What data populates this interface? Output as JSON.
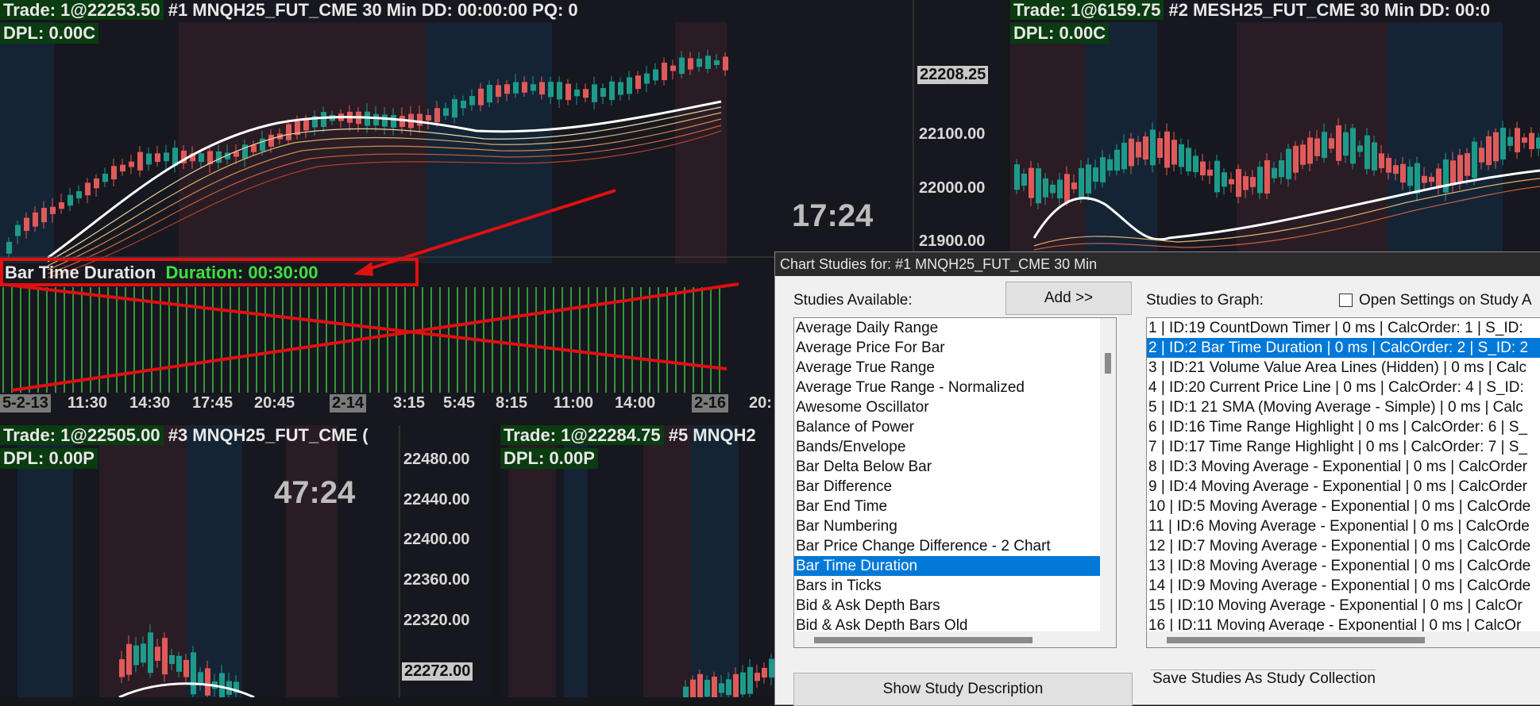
{
  "chart1": {
    "trade_label": "Trade: 1@22253.50",
    "title_rest": " #1 MNQH25_FUT_CME  30 Min  DD: 00:00:00 PQ: 0",
    "dpl": "DPL: 0.00C",
    "current_price": "22208.25",
    "price_labels": [
      "22100.00",
      "22000.00",
      "21900.00"
    ],
    "countdown": "17:24",
    "study_name": "Bar Time Duration",
    "study_value": "Duration: 00:30:00",
    "time_axis": [
      "5-2-13",
      "11:30",
      "14:30",
      "17:45",
      "20:45",
      "2-14",
      "3:15",
      "5:45",
      "8:15",
      "11:00",
      "14:00",
      "2-16",
      "20:"
    ]
  },
  "chart2": {
    "trade_label": "Trade: 1@6159.75",
    "title_rest": " #2 MESH25_FUT_CME  30 Min  DD: 00:0",
    "dpl": "DPL: 0.00C"
  },
  "chart3": {
    "trade_label": "Trade: 1@22505.00",
    "title_rest": " #3 MNQH25_FUT_CME  (",
    "dpl": "DPL: 0.00P",
    "countdown": "47:24",
    "price_labels": [
      "22480.00",
      "22440.00",
      "22400.00",
      "22360.00",
      "22320.00"
    ],
    "current_price": "22272.00"
  },
  "chart5": {
    "trade_label": "Trade: 1@22284.75",
    "title_rest": " #5 MNQH2",
    "dpl": "DPL: 0.00P"
  },
  "dialog": {
    "title": "Chart Studies for: #1 MNQH25_FUT_CME  30 Min",
    "studies_available_label": "Studies Available:",
    "add_button": "Add >>",
    "studies_to_graph_label": "Studies to Graph:",
    "open_settings_label": "Open Settings on Study A",
    "available": [
      "Average Daily Range",
      "Average Price For Bar",
      "Average True Range",
      "Average True Range - Normalized",
      "Awesome Oscillator",
      "Balance of Power",
      "Bands/Envelope",
      "Bar Delta Below Bar",
      "Bar Difference",
      "Bar End Time",
      "Bar Numbering",
      "Bar Price Change Difference - 2 Chart",
      "Bar Time Duration",
      "Bars in Ticks",
      "Bid & Ask Depth Bars",
      "Bid & Ask Depth Bars Old"
    ],
    "available_selected": "Bar Time Duration",
    "graphed": [
      "1 | ID:19  CountDown Timer | 0 ms | CalcOrder: 1 | S_ID:",
      "2 | ID:2  Bar Time Duration | 0 ms | CalcOrder: 2 | S_ID: 2",
      "3 | ID:21  Volume Value Area Lines (Hidden) | 0 ms | Calc",
      "4 | ID:20  Current Price Line | 0 ms | CalcOrder: 4 | S_ID:",
      "5 | ID:1  21 SMA (Moving Average - Simple) | 0 ms | Calc",
      "6 | ID:16  Time Range Highlight | 0 ms | CalcOrder: 6 | S_",
      "7 | ID:17  Time Range Highlight | 0 ms | CalcOrder: 7 | S_",
      "8 | ID:3  Moving Average - Exponential | 0 ms | CalcOrder",
      "9 | ID:4  Moving Average - Exponential | 0 ms | CalcOrder",
      "10 | ID:5  Moving Average - Exponential | 0 ms | CalcOrde",
      "11 | ID:6  Moving Average - Exponential | 0 ms | CalcOrde",
      "12 | ID:7  Moving Average - Exponential | 0 ms | CalcOrde",
      "13 | ID:8  Moving Average - Exponential | 0 ms | CalcOrde",
      "14 | ID:9  Moving Average - Exponential | 0 ms | CalcOrde",
      "15 | ID:10  Moving Average - Exponential | 0 ms | CalcOr",
      "16 | ID:11  Moving Average - Exponential | 0 ms | CalcOr"
    ],
    "graphed_selected_index": 1,
    "show_description_button": "Show Study Description",
    "save_collection_label": "Save Studies As Study Collection"
  },
  "colors": {
    "up_candle": "#1e9a8a",
    "down_candle": "#e05a5a",
    "duration_bar": "#3ec43e",
    "annotation": "#e01010",
    "selection": "#0078d7"
  }
}
